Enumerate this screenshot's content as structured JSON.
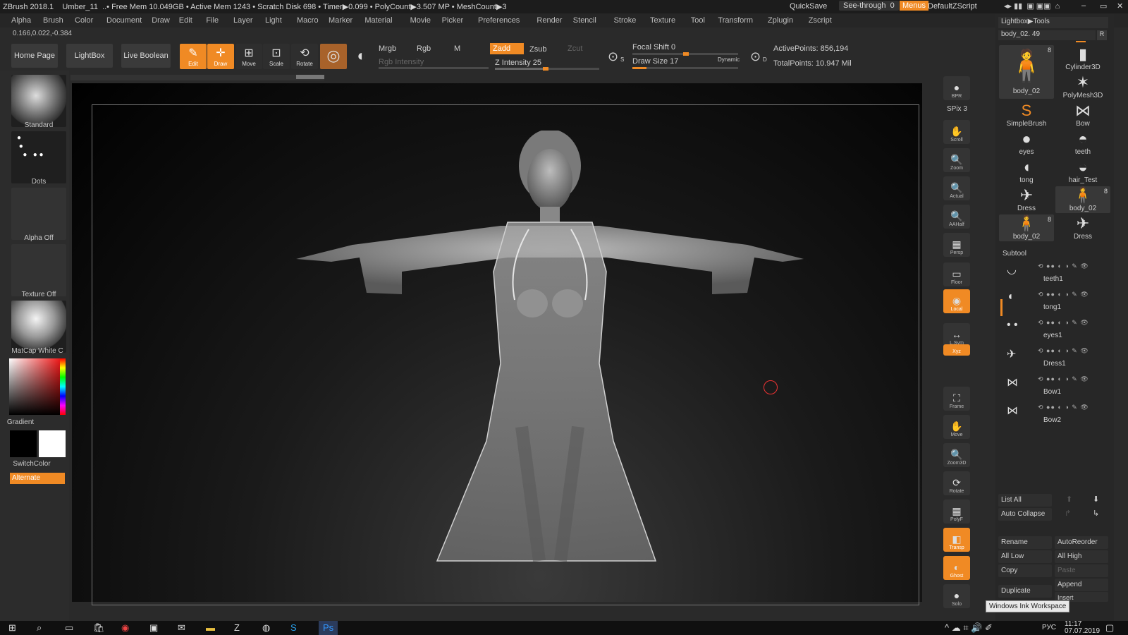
{
  "title": {
    "app": "ZBrush 2018.1",
    "doc": "Umber_11",
    "stats": "..• Free Mem 10.049GB • Active Mem 1243 • Scratch Disk 698 • Timer▶0.099 • PolyCount▶3.507 MP • MeshCount▶3",
    "quicksave": "QuickSave",
    "seethrough": "See-through",
    "seethrough_val": "0",
    "menus": "Menus",
    "script": "DefaultZScript"
  },
  "menu": [
    "Alpha",
    "Brush",
    "Color",
    "Document",
    "Draw",
    "Edit",
    "File",
    "Layer",
    "Light",
    "Macro",
    "Marker",
    "Material",
    "Movie",
    "Picker",
    "Preferences",
    "Render",
    "Stencil",
    "Stroke",
    "Texture",
    "Tool",
    "Transform",
    "Zplugin",
    "Zscript"
  ],
  "coords": "0.166,0.022,-0.384",
  "toolbar": {
    "home": "Home Page",
    "lightbox": "LightBox",
    "live_boolean": "Live Boolean",
    "edit": "Edit",
    "draw": "Draw",
    "move": "Move",
    "scale": "Scale",
    "rotate": "Rotate",
    "mrgb": "Mrgb",
    "rgb": "Rgb",
    "m": "M",
    "zadd": "Zadd",
    "zsub": "Zsub",
    "zcut": "Zcut",
    "rgb_intensity": "Rgb Intensity",
    "z_intensity": "Z Intensity 25",
    "focal_shift": "Focal Shift 0",
    "draw_size": "Draw Size 17",
    "dynamic": "Dynamic",
    "active_points": "ActivePoints: 856,194",
    "total_points": "TotalPoints: 10.947 Mil",
    "s": "S",
    "d": "D"
  },
  "left": {
    "brush": "Standard",
    "stroke": "Dots",
    "alpha": "Alpha Off",
    "texture": "Texture Off",
    "material": "MatCap White C",
    "gradient": "Gradient",
    "switch": "SwitchColor",
    "alternate": "Alternate"
  },
  "shelf": [
    {
      "label": "BPR",
      "icon": "●"
    },
    {
      "label": "SPix 3",
      "icon": ""
    },
    {
      "label": "Scroll",
      "icon": "✋"
    },
    {
      "label": "Zoom",
      "icon": "🔍"
    },
    {
      "label": "Actual",
      "icon": "🔍"
    },
    {
      "label": "AAHalf",
      "icon": "🔍"
    },
    {
      "label": "Persp",
      "icon": "▦"
    },
    {
      "label": "Floor",
      "icon": "▭"
    },
    {
      "label": "Local",
      "icon": "◉"
    },
    {
      "label": "L.Sym",
      "icon": "↔"
    },
    {
      "label": "Xyz",
      "icon": "⊕"
    },
    {
      "label": "Frame",
      "icon": "⛶"
    },
    {
      "label": "Move",
      "icon": "✋"
    },
    {
      "label": "Zoom3D",
      "icon": "🔍"
    },
    {
      "label": "Rotate",
      "icon": "⟳"
    },
    {
      "label": "PolyF",
      "icon": "▦"
    },
    {
      "label": "Transp",
      "icon": "◧"
    },
    {
      "label": "Ghost",
      "icon": "◐"
    },
    {
      "label": "Solo",
      "icon": "●"
    }
  ],
  "right": {
    "header": "Lightbox▶Tools",
    "tool_name": "body_02. 49",
    "r": "R",
    "subtool_title": "Subtool",
    "list_all": "List All",
    "auto_collapse": "Auto Collapse",
    "rename": "Rename",
    "autoreorder": "AutoReorder",
    "all_low": "All Low",
    "all_high": "All High",
    "copy": "Copy",
    "paste": "Paste",
    "append": "Append",
    "duplicate": "Duplicate",
    "insert": "Insert",
    "tooltip": "Windows Ink Workspace"
  },
  "tools": [
    {
      "label": "body_02",
      "icon": "🧍",
      "badge": "8"
    },
    {
      "label": "Cylinder3D",
      "icon": "▮",
      "badge": ""
    },
    {
      "label": "PolyMesh3D",
      "icon": "✶",
      "badge": ""
    },
    {
      "label": "SimpleBrush",
      "icon": "S",
      "badge": ""
    },
    {
      "label": "Bow",
      "icon": "⋈",
      "badge": ""
    },
    {
      "label": "eyes",
      "icon": "●",
      "badge": ""
    },
    {
      "label": "teeth",
      "icon": "◓",
      "badge": ""
    },
    {
      "label": "tong",
      "icon": "◖",
      "badge": ""
    },
    {
      "label": "hair_Test",
      "icon": "◒",
      "badge": ""
    },
    {
      "label": "Dress",
      "icon": "✈",
      "badge": ""
    },
    {
      "label": "body_02",
      "icon": "🧍",
      "badge": "8"
    },
    {
      "label": "body_02",
      "icon": "🧍",
      "badge": "8"
    },
    {
      "label": "Dress",
      "icon": "✈",
      "badge": ""
    }
  ],
  "subtools": [
    {
      "label": "teeth1"
    },
    {
      "label": "tong1"
    },
    {
      "label": "eyes1"
    },
    {
      "label": "Dress1"
    },
    {
      "label": "Bow1"
    },
    {
      "label": "Bow2"
    }
  ],
  "taskbar": {
    "time": "11:17",
    "date": "07.07.2019",
    "lang": "РУС"
  }
}
